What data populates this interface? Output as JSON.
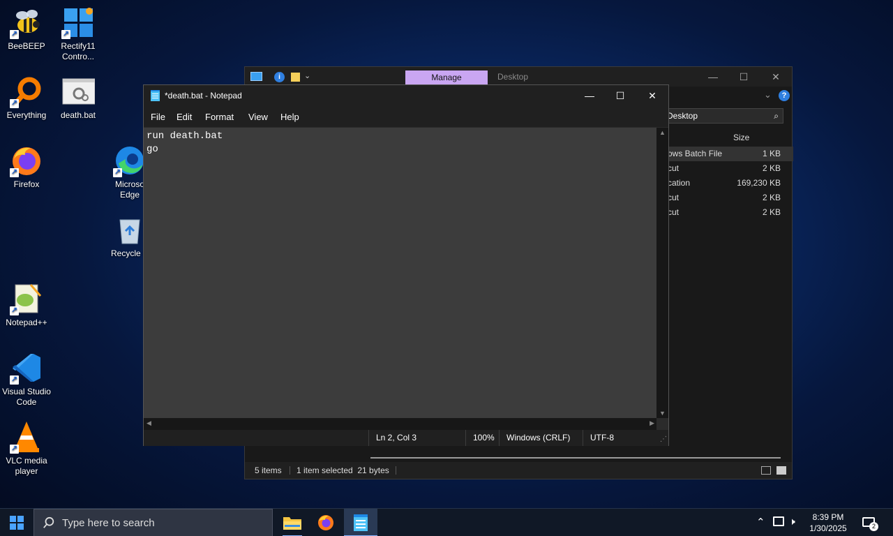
{
  "desktop": {
    "icons": [
      {
        "label": "BeeBEEP",
        "icon": "bee-icon"
      },
      {
        "label": "Rectify11 Contro...",
        "icon": "windows-logo-icon"
      },
      {
        "label": "Everything",
        "icon": "magnifier-icon"
      },
      {
        "label": "death.bat",
        "icon": "batch-file-icon"
      },
      {
        "label": "Firefox",
        "icon": "firefox-icon"
      },
      {
        "label": "Microso Edge",
        "icon": "edge-icon"
      },
      {
        "label": "Recycle B",
        "icon": "recycle-bin-icon"
      },
      {
        "label": "Notepad++",
        "icon": "notepadpp-icon"
      },
      {
        "label": "Visual Studio Code",
        "icon": "vscode-icon"
      },
      {
        "label": "VLC media player",
        "icon": "vlc-icon"
      }
    ]
  },
  "explorer": {
    "manage_tab": "Manage",
    "desktop_tab": "Desktop",
    "search_text": "h Desktop",
    "column_size": "Size",
    "rows": [
      {
        "type": "ows Batch File",
        "size": "1 KB"
      },
      {
        "type": "cut",
        "size": "2 KB"
      },
      {
        "type": "cation",
        "size": "169,230 KB"
      },
      {
        "type": "cut",
        "size": "2 KB"
      },
      {
        "type": "cut",
        "size": "2 KB"
      }
    ],
    "status_items": "5 items",
    "status_selected": "1 item selected  21 bytes"
  },
  "notepad": {
    "title": "*death.bat - Notepad",
    "menu": [
      "File",
      "Edit",
      "Format",
      "View",
      "Help"
    ],
    "content": "run death.bat\ngo",
    "status": {
      "position": "Ln 2, Col 3",
      "zoom": "100%",
      "line_ending": "Windows (CRLF)",
      "encoding": "UTF-8"
    }
  },
  "taskbar": {
    "search_placeholder": "Type here to search",
    "time": "8:39 PM",
    "date": "1/30/2025",
    "notification_count": "2"
  },
  "colors": {
    "manage_accent": "#c9a6f2",
    "taskbar_bg": "#101826",
    "editor_bg": "#3c3c3c"
  }
}
